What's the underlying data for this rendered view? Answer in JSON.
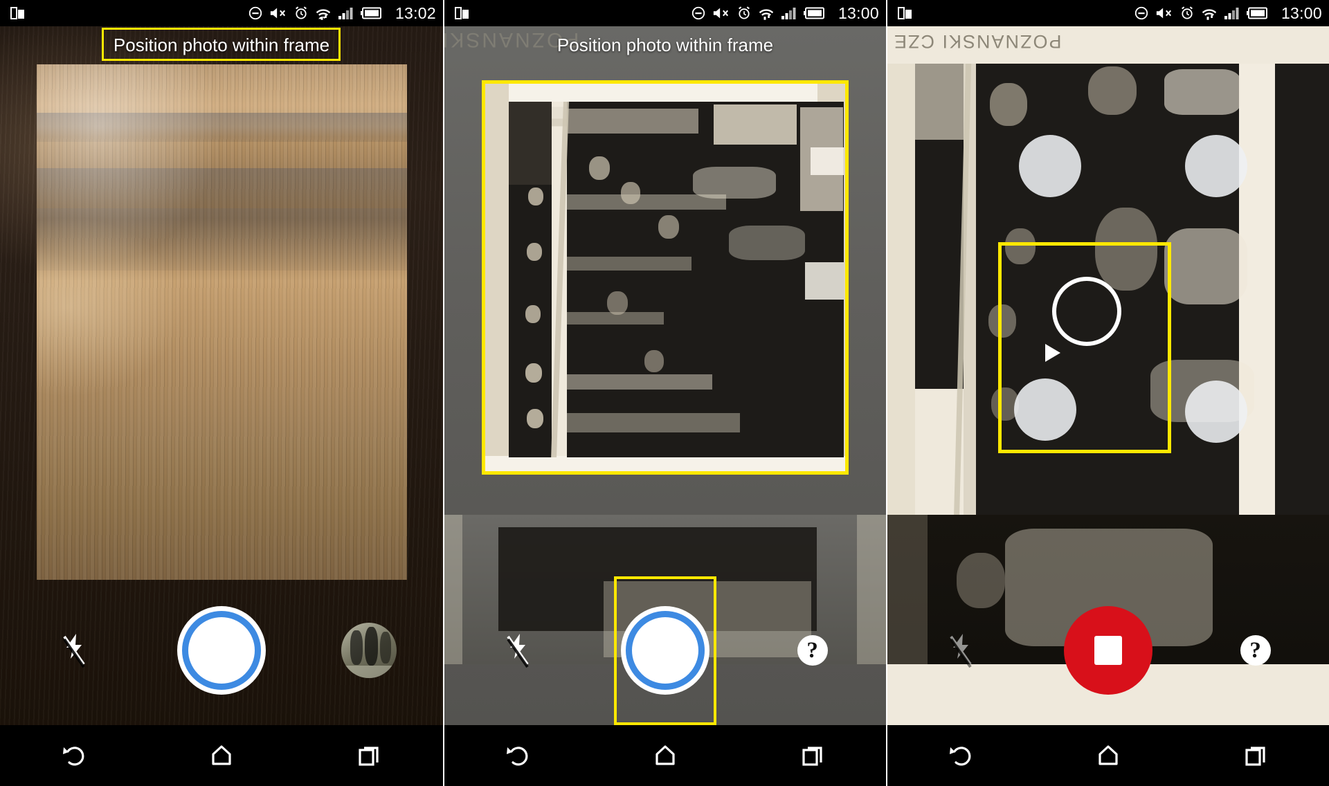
{
  "meta": {
    "app": "PhotoScan-style camera capture",
    "panel_count": 3
  },
  "accent_colors": {
    "annotation_yellow": "#ffe800",
    "shutter_blue": "#3d8ae2",
    "record_red": "#d8101a",
    "nav_black": "#000000",
    "dot_white": "#eef0f2"
  },
  "panels": [
    {
      "id": "panel-1",
      "statusbar": {
        "left_icon": "split-screen-icon",
        "icons": [
          "do-not-disturb-icon",
          "volume-mute-icon",
          "alarm-icon",
          "wifi-icon",
          "signal-bars-icon",
          "battery-icon"
        ],
        "clock": "13:02"
      },
      "hint": "Position photo within frame",
      "hint_highlighted": true,
      "viewfinder": "wooden desk surface with blank photo frame area",
      "controls": {
        "flash_label": "flash-off",
        "shutter_label": "shutter",
        "right_control": "gallery-thumbnail"
      },
      "navbar": [
        "back",
        "home",
        "recents"
      ]
    },
    {
      "id": "panel-2",
      "statusbar": {
        "left_icon": "split-screen-icon",
        "icons": [
          "do-not-disturb-icon",
          "volume-mute-icon",
          "alarm-icon",
          "wifi-icon",
          "signal-bars-icon",
          "battery-icon"
        ],
        "clock": "13:00"
      },
      "hint": "Position photo within frame",
      "hint_highlighted": false,
      "viewfinder": "sepia group photograph framed by yellow detection border",
      "photo_caption": "POZNANSKI",
      "controls": {
        "flash_label": "flash-off",
        "shutter_label": "shutter",
        "shutter_highlighted": true,
        "right_control": "help"
      },
      "navbar": [
        "back",
        "home",
        "recents"
      ]
    },
    {
      "id": "panel-3",
      "statusbar": {
        "left_icon": "split-screen-icon",
        "icons": [
          "do-not-disturb-icon",
          "volume-mute-icon",
          "alarm-icon",
          "wifi-icon",
          "signal-bars-icon",
          "battery-icon"
        ],
        "clock": "13:00"
      },
      "hint": "",
      "viewfinder": "zoomed scan guidance with four white target dots and aiming reticle",
      "photo_caption": "POZNANSKI CZE",
      "capture_dots": 4,
      "reticle": "aiming-circle",
      "crop_box_visible": true,
      "controls": {
        "flash_label": "flash-off",
        "shutter_label": "stop-capture",
        "right_control": "help"
      },
      "navbar": [
        "back",
        "home",
        "recents"
      ]
    }
  ],
  "icons": {
    "flash_off": "flash-off-icon",
    "help": "?",
    "back": "back-arrow-icon",
    "home": "home-icon",
    "recents": "recents-icon",
    "thumbnail": "gallery-thumbnail-icon"
  }
}
